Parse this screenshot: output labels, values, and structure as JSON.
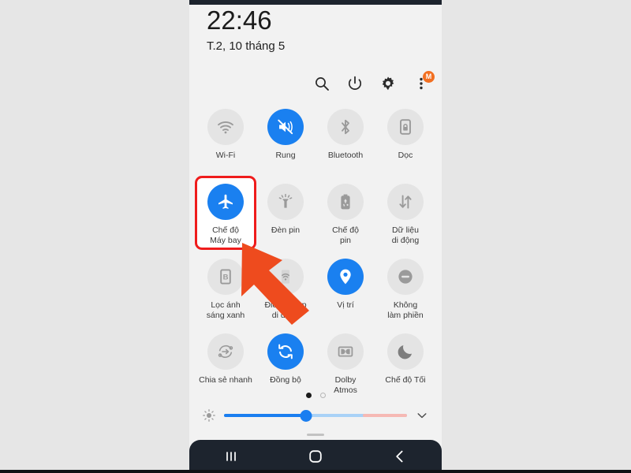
{
  "statusbar": {
    "time": "22:46",
    "date": "T.2, 10 tháng 5"
  },
  "header": {
    "icons": [
      {
        "name": "search-icon",
        "label": "Tìm kiếm"
      },
      {
        "name": "power-icon",
        "label": "Nguồn"
      },
      {
        "name": "gear-icon",
        "label": "Cài đặt"
      },
      {
        "name": "more-menu-icon",
        "label": "Thêm"
      }
    ],
    "badge": "M"
  },
  "tiles": [
    {
      "label": "Wi-Fi",
      "icon": "wifi-icon",
      "active": false,
      "highlight": false
    },
    {
      "label": "Rung",
      "icon": "vibrate-icon",
      "active": true,
      "highlight": false
    },
    {
      "label": "Bluetooth",
      "icon": "bluetooth-icon",
      "active": false,
      "highlight": false
    },
    {
      "label": "Dọc",
      "icon": "rotation-lock-icon",
      "active": false,
      "highlight": false
    },
    {
      "label": "Chế độ\nMáy bay",
      "icon": "airplane-icon",
      "active": true,
      "highlight": true
    },
    {
      "label": "Đèn pin",
      "icon": "flashlight-icon",
      "active": false,
      "highlight": false
    },
    {
      "label": "Chế độ\npin",
      "icon": "battery-saver-icon",
      "active": false,
      "highlight": false
    },
    {
      "label": "Dữ liệu\ndi động",
      "icon": "mobile-data-icon",
      "active": false,
      "highlight": false
    },
    {
      "label": "Lọc ánh\nsáng xanh",
      "icon": "blue-light-icon",
      "active": false,
      "highlight": false
    },
    {
      "label": "Điểm tr.cập\ndi động",
      "icon": "hotspot-icon",
      "active": false,
      "highlight": false
    },
    {
      "label": "Vị trí",
      "icon": "location-icon",
      "active": true,
      "highlight": false
    },
    {
      "label": "Không\nlàm phiền",
      "icon": "dnd-icon",
      "active": false,
      "highlight": false
    },
    {
      "label": "Chia sẻ nhanh",
      "icon": "quick-share-icon",
      "active": false,
      "highlight": false
    },
    {
      "label": "Đồng bộ",
      "icon": "sync-icon",
      "active": true,
      "highlight": false
    },
    {
      "label": "Dolby\nAtmos",
      "icon": "dolby-icon",
      "active": false,
      "highlight": false
    },
    {
      "label": "Chế độ Tối",
      "icon": "dark-mode-icon",
      "active": false,
      "highlight": false
    }
  ],
  "pager": {
    "pages": 2,
    "current": 1
  },
  "brightness": {
    "value": 45,
    "icon": "brightness-icon",
    "expand_icon": "chevron-down-icon"
  },
  "navbar": [
    {
      "name": "recents-button",
      "label": "Gần đây"
    },
    {
      "name": "home-button",
      "label": "Trang chủ"
    },
    {
      "name": "back-button",
      "label": "Quay lại"
    }
  ],
  "annotation": {
    "arrow_color": "#ee4b1e",
    "highlight_color": "#ef1c1c",
    "target_tile": "Chế độ Máy bay"
  },
  "colors": {
    "accent": "#1a80f0",
    "panel": "#f2f2f2",
    "page": "#e6e6e6",
    "navbar": "#1d242e"
  }
}
